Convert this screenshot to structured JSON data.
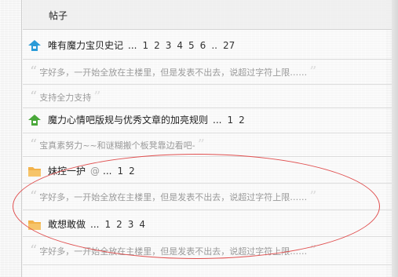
{
  "header": {
    "title": "帖子"
  },
  "threads": [
    {
      "icon": "blue-arrow-up-icon",
      "title": "唯有魔力宝贝史记",
      "ellipsis": "...",
      "pages": [
        "1",
        "2",
        "3",
        "4",
        "5",
        "6",
        "..",
        "27"
      ],
      "quote": "字好多，一开始全放在主楼里，但是发表不出去，说超过字符上限……"
    },
    {
      "quote": "支持全力支持"
    },
    {
      "icon": "green-arrow-up-icon",
      "title": "魔力心情吧版规与优秀文章的加亮规则",
      "ellipsis": "...",
      "pages": [
        "1",
        "2"
      ],
      "quote": "宝真素努力~~和谜糊搬个板凳靠边看吧-"
    },
    {
      "icon": "folder-icon",
      "title": "妹控一护",
      "attachment": "@",
      "ellipsis": "...",
      "pages": [
        "1",
        "2"
      ],
      "quote": "字好多，一开始全放在主楼里，但是发表不出去，说超过字符上限……"
    },
    {
      "icon": "folder-icon",
      "title": "敢想敢做",
      "ellipsis": "...",
      "pages": [
        "1",
        "2",
        "3",
        "4"
      ],
      "quote": "字好多，一开始全放在主楼里，但是发表不出去，说超过字符上限……"
    }
  ],
  "colors": {
    "annotation": "#e05050",
    "folder": "#f2b24a",
    "blue_icon": "#2a9bd8",
    "green_icon": "#4aa83a"
  }
}
